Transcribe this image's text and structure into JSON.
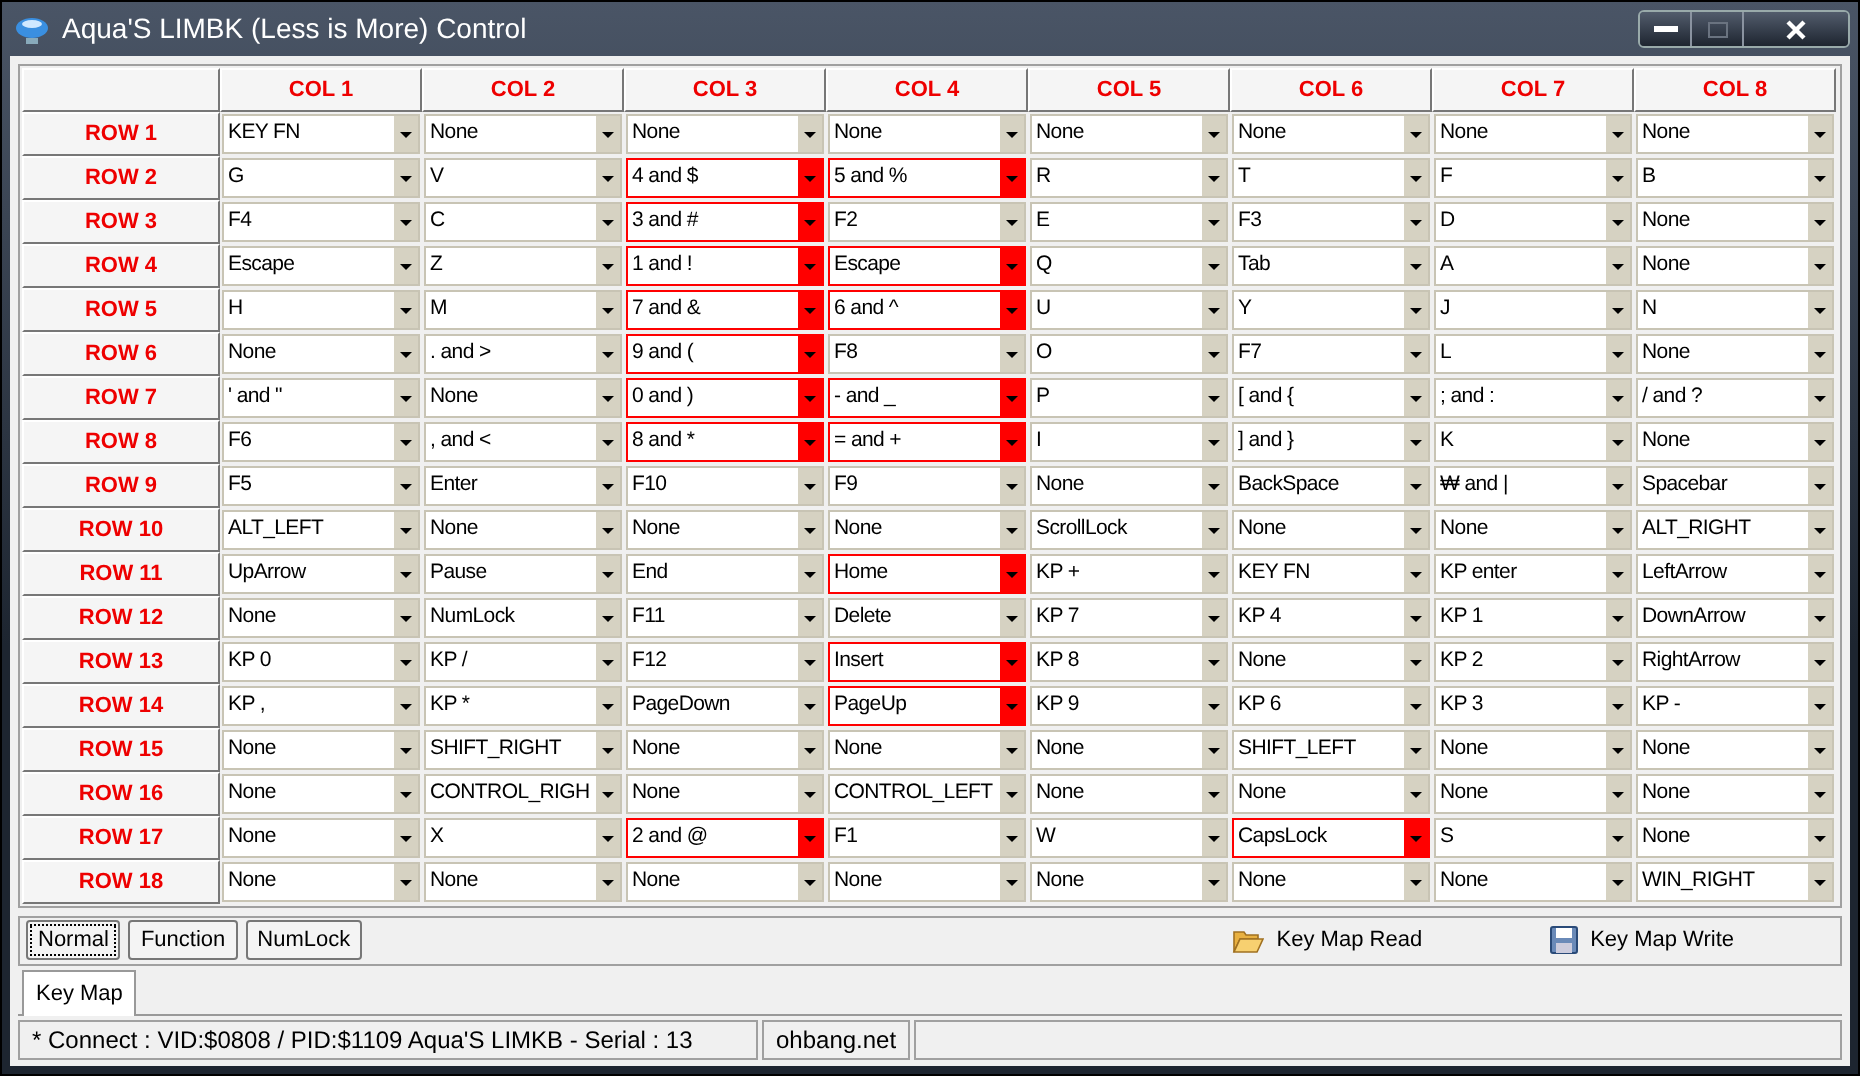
{
  "window": {
    "title": "Aqua'S LIMBK (Less is More) Control"
  },
  "grid": {
    "columns": [
      "COL 1",
      "COL 2",
      "COL 3",
      "COL 4",
      "COL 5",
      "COL 6",
      "COL 7",
      "COL 8"
    ],
    "rows": [
      {
        "label": "ROW 1",
        "cells": [
          {
            "value": "KEY FN",
            "highlighted": false
          },
          {
            "value": "None",
            "highlighted": false
          },
          {
            "value": "None",
            "highlighted": false
          },
          {
            "value": "None",
            "highlighted": false
          },
          {
            "value": "None",
            "highlighted": false
          },
          {
            "value": "None",
            "highlighted": false
          },
          {
            "value": "None",
            "highlighted": false
          },
          {
            "value": "None",
            "highlighted": false
          }
        ]
      },
      {
        "label": "ROW 2",
        "cells": [
          {
            "value": "G",
            "highlighted": false
          },
          {
            "value": "V",
            "highlighted": false
          },
          {
            "value": "4 and $",
            "highlighted": true
          },
          {
            "value": "5 and %",
            "highlighted": true
          },
          {
            "value": "R",
            "highlighted": false
          },
          {
            "value": "T",
            "highlighted": false
          },
          {
            "value": "F",
            "highlighted": false
          },
          {
            "value": "B",
            "highlighted": false
          }
        ]
      },
      {
        "label": "ROW 3",
        "cells": [
          {
            "value": "F4",
            "highlighted": false
          },
          {
            "value": "C",
            "highlighted": false
          },
          {
            "value": "3 and #",
            "highlighted": true
          },
          {
            "value": "F2",
            "highlighted": false
          },
          {
            "value": "E",
            "highlighted": false
          },
          {
            "value": "F3",
            "highlighted": false
          },
          {
            "value": "D",
            "highlighted": false
          },
          {
            "value": "None",
            "highlighted": false
          }
        ]
      },
      {
        "label": "ROW 4",
        "cells": [
          {
            "value": "Escape",
            "highlighted": false
          },
          {
            "value": "Z",
            "highlighted": false
          },
          {
            "value": "1 and !",
            "highlighted": true
          },
          {
            "value": "Escape",
            "highlighted": true
          },
          {
            "value": "Q",
            "highlighted": false
          },
          {
            "value": "Tab",
            "highlighted": false
          },
          {
            "value": "A",
            "highlighted": false
          },
          {
            "value": "None",
            "highlighted": false
          }
        ]
      },
      {
        "label": "ROW 5",
        "cells": [
          {
            "value": "H",
            "highlighted": false
          },
          {
            "value": "M",
            "highlighted": false
          },
          {
            "value": "7 and &",
            "highlighted": true
          },
          {
            "value": "6 and ^",
            "highlighted": true
          },
          {
            "value": "U",
            "highlighted": false
          },
          {
            "value": "Y",
            "highlighted": false
          },
          {
            "value": "J",
            "highlighted": false
          },
          {
            "value": "N",
            "highlighted": false
          }
        ]
      },
      {
        "label": "ROW 6",
        "cells": [
          {
            "value": "None",
            "highlighted": false
          },
          {
            "value": ". and >",
            "highlighted": false
          },
          {
            "value": "9 and (",
            "highlighted": true
          },
          {
            "value": "F8",
            "highlighted": false
          },
          {
            "value": "O",
            "highlighted": false
          },
          {
            "value": "F7",
            "highlighted": false
          },
          {
            "value": "L",
            "highlighted": false
          },
          {
            "value": "None",
            "highlighted": false
          }
        ]
      },
      {
        "label": "ROW 7",
        "cells": [
          {
            "value": "' and \"",
            "highlighted": false
          },
          {
            "value": "None",
            "highlighted": false
          },
          {
            "value": "0 and )",
            "highlighted": true
          },
          {
            "value": "- and _",
            "highlighted": true
          },
          {
            "value": "P",
            "highlighted": false
          },
          {
            "value": "[ and {",
            "highlighted": false
          },
          {
            "value": "; and :",
            "highlighted": false
          },
          {
            "value": "/ and ?",
            "highlighted": false
          }
        ]
      },
      {
        "label": "ROW 8",
        "cells": [
          {
            "value": "F6",
            "highlighted": false
          },
          {
            "value": ", and <",
            "highlighted": false
          },
          {
            "value": "8 and *",
            "highlighted": true
          },
          {
            "value": "= and +",
            "highlighted": true
          },
          {
            "value": "I",
            "highlighted": false
          },
          {
            "value": "] and }",
            "highlighted": false
          },
          {
            "value": "K",
            "highlighted": false
          },
          {
            "value": "None",
            "highlighted": false
          }
        ]
      },
      {
        "label": "ROW 9",
        "cells": [
          {
            "value": "F5",
            "highlighted": false
          },
          {
            "value": "Enter",
            "highlighted": false
          },
          {
            "value": "F10",
            "highlighted": false
          },
          {
            "value": "F9",
            "highlighted": false
          },
          {
            "value": "None",
            "highlighted": false
          },
          {
            "value": "BackSpace",
            "highlighted": false
          },
          {
            "value": "₩ and |",
            "highlighted": false
          },
          {
            "value": "Spacebar",
            "highlighted": false
          }
        ]
      },
      {
        "label": "ROW 10",
        "cells": [
          {
            "value": "ALT_LEFT",
            "highlighted": false
          },
          {
            "value": "None",
            "highlighted": false
          },
          {
            "value": "None",
            "highlighted": false
          },
          {
            "value": "None",
            "highlighted": false
          },
          {
            "value": "ScrollLock",
            "highlighted": false
          },
          {
            "value": "None",
            "highlighted": false
          },
          {
            "value": "None",
            "highlighted": false
          },
          {
            "value": "ALT_RIGHT",
            "highlighted": false
          }
        ]
      },
      {
        "label": "ROW 11",
        "cells": [
          {
            "value": "UpArrow",
            "highlighted": false
          },
          {
            "value": "Pause",
            "highlighted": false
          },
          {
            "value": "End",
            "highlighted": false
          },
          {
            "value": "Home",
            "highlighted": true
          },
          {
            "value": "KP +",
            "highlighted": false
          },
          {
            "value": "KEY FN",
            "highlighted": false
          },
          {
            "value": "KP enter",
            "highlighted": false
          },
          {
            "value": "LeftArrow",
            "highlighted": false
          }
        ]
      },
      {
        "label": "ROW 12",
        "cells": [
          {
            "value": "None",
            "highlighted": false
          },
          {
            "value": "NumLock",
            "highlighted": false
          },
          {
            "value": "F11",
            "highlighted": false
          },
          {
            "value": "Delete",
            "highlighted": false
          },
          {
            "value": "KP 7",
            "highlighted": false
          },
          {
            "value": "KP 4",
            "highlighted": false
          },
          {
            "value": "KP 1",
            "highlighted": false
          },
          {
            "value": "DownArrow",
            "highlighted": false
          }
        ]
      },
      {
        "label": "ROW 13",
        "cells": [
          {
            "value": "KP 0",
            "highlighted": false
          },
          {
            "value": "KP /",
            "highlighted": false
          },
          {
            "value": "F12",
            "highlighted": false
          },
          {
            "value": "Insert",
            "highlighted": true
          },
          {
            "value": "KP 8",
            "highlighted": false
          },
          {
            "value": "None",
            "highlighted": false
          },
          {
            "value": "KP 2",
            "highlighted": false
          },
          {
            "value": "RightArrow",
            "highlighted": false
          }
        ]
      },
      {
        "label": "ROW 14",
        "cells": [
          {
            "value": "KP ,",
            "highlighted": false
          },
          {
            "value": "KP *",
            "highlighted": false
          },
          {
            "value": "PageDown",
            "highlighted": false
          },
          {
            "value": "PageUp",
            "highlighted": true
          },
          {
            "value": "KP 9",
            "highlighted": false
          },
          {
            "value": "KP 6",
            "highlighted": false
          },
          {
            "value": "KP 3",
            "highlighted": false
          },
          {
            "value": "KP -",
            "highlighted": false
          }
        ]
      },
      {
        "label": "ROW 15",
        "cells": [
          {
            "value": "None",
            "highlighted": false
          },
          {
            "value": "SHIFT_RIGHT",
            "highlighted": false
          },
          {
            "value": "None",
            "highlighted": false
          },
          {
            "value": "None",
            "highlighted": false
          },
          {
            "value": "None",
            "highlighted": false
          },
          {
            "value": "SHIFT_LEFT",
            "highlighted": false
          },
          {
            "value": "None",
            "highlighted": false
          },
          {
            "value": "None",
            "highlighted": false
          }
        ]
      },
      {
        "label": "ROW 16",
        "cells": [
          {
            "value": "None",
            "highlighted": false
          },
          {
            "value": "CONTROL_RIGH",
            "highlighted": false
          },
          {
            "value": "None",
            "highlighted": false
          },
          {
            "value": "CONTROL_LEFT",
            "highlighted": false
          },
          {
            "value": "None",
            "highlighted": false
          },
          {
            "value": "None",
            "highlighted": false
          },
          {
            "value": "None",
            "highlighted": false
          },
          {
            "value": "None",
            "highlighted": false
          }
        ]
      },
      {
        "label": "ROW 17",
        "cells": [
          {
            "value": "None",
            "highlighted": false
          },
          {
            "value": "X",
            "highlighted": false
          },
          {
            "value": "2 and @",
            "highlighted": true
          },
          {
            "value": "F1",
            "highlighted": false
          },
          {
            "value": "W",
            "highlighted": false
          },
          {
            "value": "CapsLock",
            "highlighted": true
          },
          {
            "value": "S",
            "highlighted": false
          },
          {
            "value": "None",
            "highlighted": false
          }
        ]
      },
      {
        "label": "ROW 18",
        "cells": [
          {
            "value": "None",
            "highlighted": false
          },
          {
            "value": "None",
            "highlighted": false
          },
          {
            "value": "None",
            "highlighted": false
          },
          {
            "value": "None",
            "highlighted": false
          },
          {
            "value": "None",
            "highlighted": false
          },
          {
            "value": "None",
            "highlighted": false
          },
          {
            "value": "None",
            "highlighted": false
          },
          {
            "value": "WIN_RIGHT",
            "highlighted": false
          }
        ]
      }
    ]
  },
  "mode_buttons": [
    {
      "label": "Normal",
      "selected": true
    },
    {
      "label": "Function",
      "selected": false
    },
    {
      "label": "NumLock",
      "selected": false
    }
  ],
  "actions": [
    {
      "label": "Key Map Read",
      "kind": "read"
    },
    {
      "label": "Key Map Write",
      "kind": "write"
    }
  ],
  "tabs": [
    {
      "label": "Key Map",
      "selected": true
    }
  ],
  "status_bar": [
    "* Connect : VID:$0808 / PID:$1109 Aqua'S LIMKB - Serial : 13",
    "ohbang.net"
  ]
}
